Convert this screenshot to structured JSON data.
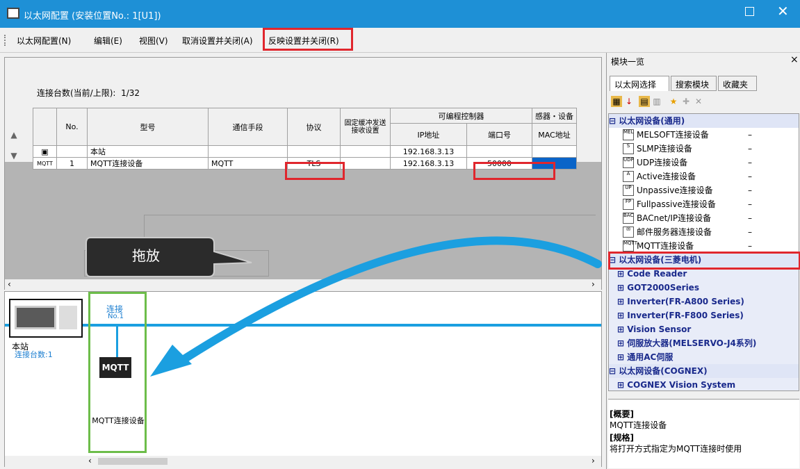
{
  "window": {
    "title": "以太网配置 (安装位置No.:  1[U1])",
    "maximize": "□",
    "close": "✕"
  },
  "menu": [
    "以太网配置(N)",
    "编辑(E)",
    "视图(V)",
    "取消设置并关闭(A)",
    "反映设置并关闭(R)"
  ],
  "conn_count": {
    "label": "连接台数(当前/上限):",
    "value": "1/32"
  },
  "table": {
    "headers": {
      "no": "No.",
      "model": "型号",
      "comm": "通信手段",
      "protocol": "协议",
      "fixed_buffer": "固定缓冲发送接收设置",
      "plc": "可编程控制器",
      "sensor": "感器・设备",
      "ip": "IP地址",
      "port": "端口号",
      "mac": "MAC地址"
    },
    "rows": [
      {
        "no": "",
        "model": "本站",
        "comm": "",
        "protocol": "",
        "ip": "192.168.3.13",
        "port": ""
      },
      {
        "no": "1",
        "model": "MQTT连接设备",
        "comm": "MQTT",
        "protocol": "TLS",
        "ip": "192.168.3.13",
        "port": "50000"
      }
    ]
  },
  "callout": "拖放",
  "diagram": {
    "conn_label": "连接",
    "conn_no": "No.1",
    "station": "本站",
    "conn_count": "连接台数:1",
    "mqtt_badge": "MQTT",
    "mqtt_label": "MQTT连接设备"
  },
  "right": {
    "title": "模块一览",
    "close": "×",
    "tabs": [
      "以太网选择",
      "搜索模块",
      "收藏夹"
    ],
    "tree": [
      {
        "type": "group",
        "label": "以太网设备(通用)"
      },
      {
        "type": "device",
        "icon": "MEL",
        "label": "MELSOFT连接设备",
        "dash": "–"
      },
      {
        "type": "device",
        "icon": "S",
        "label": "SLMP连接设备",
        "dash": "–"
      },
      {
        "type": "device",
        "icon": "UDP",
        "label": "UDP连接设备",
        "dash": "–"
      },
      {
        "type": "device",
        "icon": "A",
        "label": "Active连接设备",
        "dash": "–"
      },
      {
        "type": "device",
        "icon": "UP",
        "label": "Unpassive连接设备",
        "dash": "–"
      },
      {
        "type": "device",
        "icon": "FP",
        "label": "Fullpassive连接设备",
        "dash": "–"
      },
      {
        "type": "device",
        "icon": "BAC",
        "label": "BACnet/IP连接设备",
        "dash": "–"
      },
      {
        "type": "device",
        "icon": "✉",
        "label": "邮件服务器连接设备",
        "dash": "–"
      },
      {
        "type": "device",
        "icon": "MQTT",
        "label": "MQTT连接设备",
        "dash": "–"
      },
      {
        "type": "group",
        "label": "以太网设备(三菱电机)"
      },
      {
        "type": "sub",
        "label": "Code Reader"
      },
      {
        "type": "sub",
        "label": "GOT2000Series"
      },
      {
        "type": "sub",
        "label": "Inverter(FR-A800 Series)"
      },
      {
        "type": "sub",
        "label": "Inverter(FR-F800 Series)"
      },
      {
        "type": "sub",
        "label": "Vision Sensor"
      },
      {
        "type": "sub",
        "label": "伺服放大器(MELSERVO-J4系列)"
      },
      {
        "type": "sub",
        "label": "通用AC伺服"
      },
      {
        "type": "group",
        "label": "以太网设备(COGNEX)"
      },
      {
        "type": "sub",
        "label": "COGNEX Vision System"
      }
    ],
    "desc_title": "[概要]",
    "desc_text": "MQTT连接设备",
    "spec_title": "[规格]",
    "spec_text": "将打开方式指定为MQTT连接时使用"
  },
  "colors": {
    "accent": "#1e90d6",
    "highlight": "#e0262d",
    "selection": "#0a64c8",
    "drag_arrow": "#1b9fe0",
    "green_box": "#6dbd4a"
  }
}
